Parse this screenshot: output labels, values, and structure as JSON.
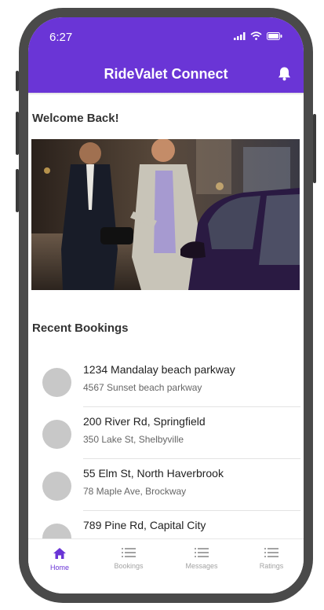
{
  "status_bar": {
    "time": "6:27"
  },
  "app": {
    "title": "RideValet Connect"
  },
  "welcome_text": "Welcome Back!",
  "recent_bookings": {
    "title": "Recent Bookings",
    "items": [
      {
        "pickup": "1234 Mandalay beach parkway",
        "dropoff": "4567 Sunset beach parkway"
      },
      {
        "pickup": "200 River Rd, Springfield",
        "dropoff": "350 Lake St, Shelbyville"
      },
      {
        "pickup": "55 Elm St, North Haverbrook",
        "dropoff": "78 Maple Ave, Brockway"
      },
      {
        "pickup": "789 Pine Rd, Capital City",
        "dropoff": ""
      }
    ]
  },
  "bottom_nav": {
    "items": [
      {
        "label": "Home",
        "icon": "home-icon",
        "active": true
      },
      {
        "label": "Bookings",
        "icon": "list-icon",
        "active": false
      },
      {
        "label": "Messages",
        "icon": "list-icon",
        "active": false
      },
      {
        "label": "Ratings",
        "icon": "list-icon",
        "active": false
      }
    ]
  },
  "colors": {
    "primary": "#6a35d6",
    "avatar_placeholder": "#c8c8c8",
    "inactive": "#a3a3a3"
  }
}
